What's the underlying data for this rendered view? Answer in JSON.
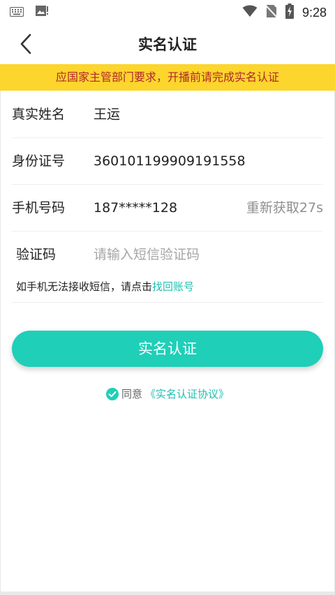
{
  "status_bar": {
    "time": "9:28",
    "icons": [
      "keyboard-icon",
      "image-notification-icon",
      "wifi-icon",
      "no-sim-icon",
      "battery-charging-icon"
    ]
  },
  "header": {
    "title": "实名认证",
    "back_icon": "chevron-left-icon"
  },
  "notice": {
    "text": "应国家主管部门要求，开播前请完成实名认证"
  },
  "form": {
    "name_label": "真实姓名",
    "name_value": "王运",
    "id_label": "身份证号",
    "id_value": "360101199909191558",
    "phone_label": "手机号码",
    "phone_value": "187*****128",
    "resend_label": "重新获取27s",
    "code_label": "验证码",
    "code_placeholder": "请输入短信验证码",
    "help_text": "如手机无法接收短信，请点击",
    "help_link": "找回账号"
  },
  "submit": {
    "label": "实名认证"
  },
  "agreement": {
    "prefix": "同意",
    "link": "《实名认证协议》"
  },
  "colors": {
    "accent": "#1fcfb8",
    "notice_bg": "#fcd52d",
    "notice_text": "#b0262b"
  }
}
